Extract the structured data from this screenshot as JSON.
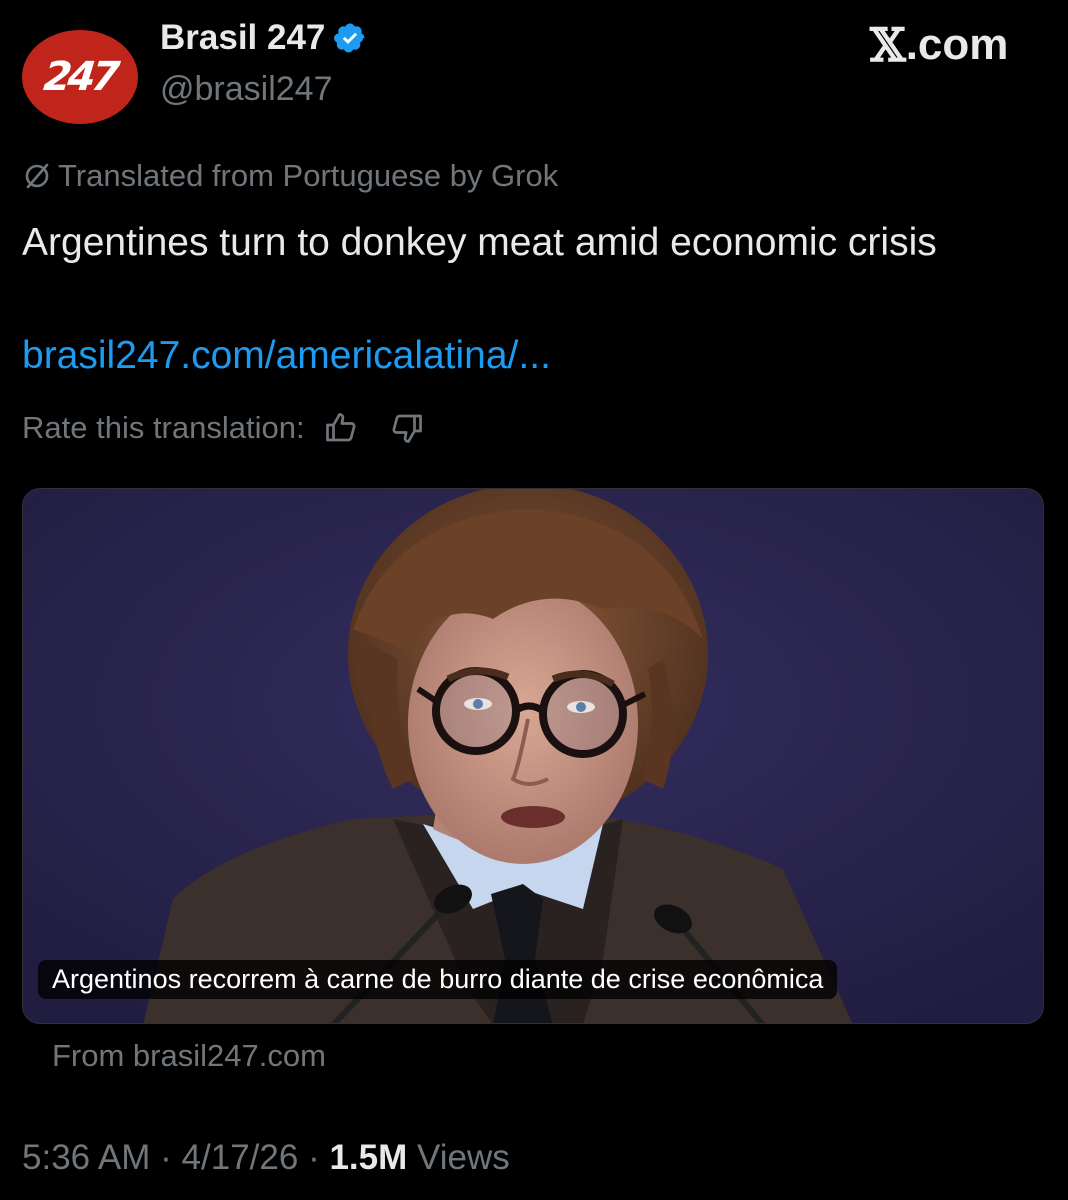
{
  "author": {
    "avatar_text": "247",
    "display_name": "Brasil 247",
    "handle": "@brasil247",
    "verified": true,
    "avatar_color": "#c0251c",
    "verified_color": "#1d9bf0"
  },
  "brand": {
    "label": ".com",
    "logo_icon": "x-logo"
  },
  "translation": {
    "notice": "Translated from Portuguese by Grok",
    "notice_icon": "grok-slash-icon",
    "rate_label": "Rate this translation:",
    "thumbs_up_icon": "thumbs-up-icon",
    "thumbs_down_icon": "thumbs-down-icon"
  },
  "tweet": {
    "text": "Argentines turn to donkey meat amid economic crisis",
    "link": "brasil247.com/americalatina/...",
    "link_color": "#1d9bf0"
  },
  "card": {
    "caption": "Argentinos recorrem à carne de burro diante de crise econômica",
    "source": "From brasil247.com"
  },
  "meta": {
    "time": "5:36 AM",
    "date": "4/17/26",
    "views_count": "1.5M",
    "views_label": "Views",
    "separator": "·"
  }
}
